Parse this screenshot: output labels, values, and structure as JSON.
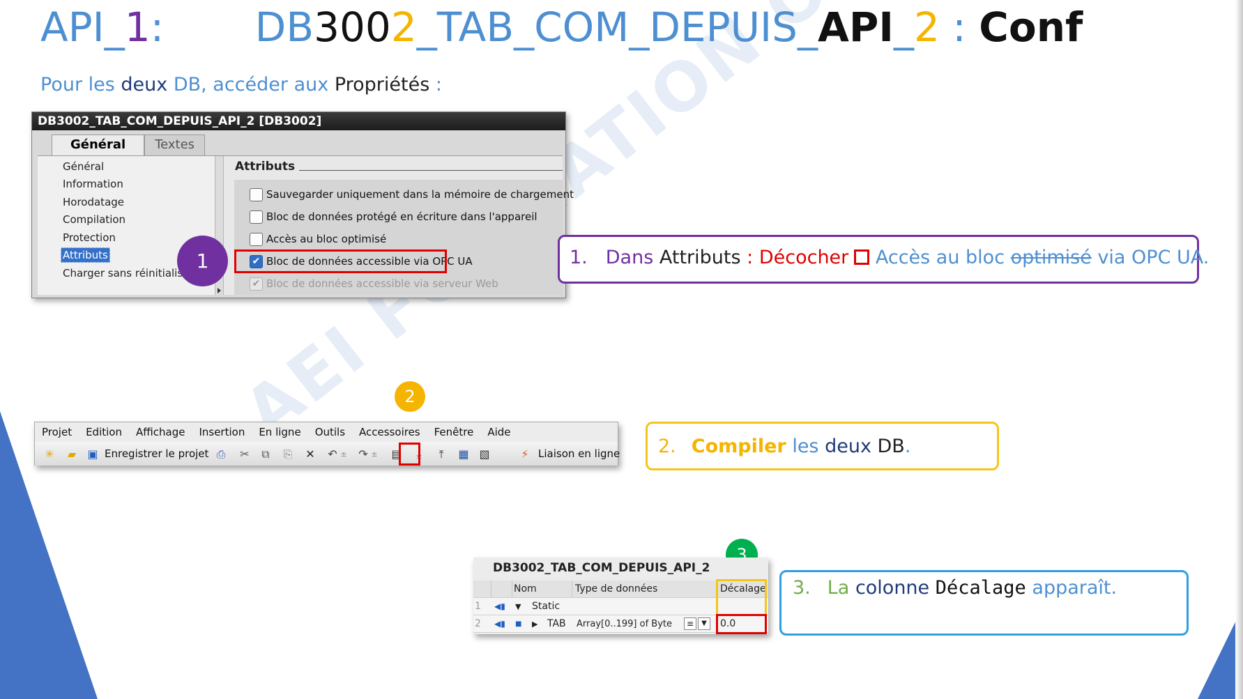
{
  "title": {
    "part1_a": "API_",
    "part1_b": "1",
    "part1_c": " :",
    "part2_a": "DB",
    "part2_b": "300",
    "part2_c": "2",
    "part2_d": "_TAB_COM_DEPUIS_",
    "part2_e": "API",
    "part2_f": "_",
    "part2_g": "2",
    "part2_h": " : ",
    "part2_i": "Conf"
  },
  "subtitle": {
    "a": "Pour les ",
    "b": "deux",
    "c": " DB, accéder aux ",
    "d": "Propriétés",
    "e": " :"
  },
  "properties_window": {
    "title": "DB3002_TAB_COM_DEPUIS_API_2 [DB3002]",
    "tabs": [
      "Général",
      "Textes"
    ],
    "nav_items": [
      "Général",
      "Information",
      "Horodatage",
      "Compilation",
      "Protection",
      "Attributs",
      "Charger sans réinitialis"
    ],
    "section_title": "Attributs",
    "checkboxes": [
      {
        "label": "Sauvegarder uniquement dans la mémoire de chargement",
        "checked": false
      },
      {
        "label": "Bloc de données protégé en écriture dans l'appareil",
        "checked": false
      },
      {
        "label": "Accès au bloc optimisé",
        "checked": false
      },
      {
        "label": "Bloc de données accessible via OPC UA",
        "checked": true
      },
      {
        "label": "Bloc de données accessible via serveur Web",
        "checked": true,
        "disabled": true
      }
    ]
  },
  "badges": {
    "one": "1",
    "two": "2",
    "three": "3"
  },
  "callout1": {
    "num": "1.",
    "a": "Dans ",
    "b": "Attributs",
    "c": " : ",
    "d": "Décocher",
    "e": " Accès au bloc ",
    "f": "optimisé",
    "g": " via OPC UA."
  },
  "toolbar_window": {
    "menu": [
      "Projet",
      "Edition",
      "Affichage",
      "Insertion",
      "En ligne",
      "Outils",
      "Accessoires",
      "Fenêtre",
      "Aide"
    ],
    "save_label": "Enregistrer le projet",
    "online_label": "Liaison en ligne"
  },
  "callout2": {
    "num": "2.",
    "a": "Compiler",
    "b": " les ",
    "c": "deux",
    "d": " DB",
    "e": "."
  },
  "table_window": {
    "title": "DB3002_TAB_COM_DEPUIS_API_2",
    "headers": [
      "Nom",
      "Type de données",
      "Décalage"
    ],
    "rows": [
      {
        "idx": "1",
        "name": "Static",
        "type": "",
        "offset": ""
      },
      {
        "idx": "2",
        "name": "TAB",
        "type": "Array[0..199] of Byte",
        "offset": "0.0"
      }
    ]
  },
  "callout3": {
    "num": "3.",
    "a": "La ",
    "b": "colonne",
    "c": " ",
    "d": "Décalage",
    "e": " apparaît."
  },
  "watermark": "AEI FORMATION OUEST",
  "colors": {
    "blue": "#4e8fd1",
    "purple": "#7030a0",
    "orange": "#f5b400",
    "green": "#00b050",
    "red": "#e00000",
    "cyan": "#2f9fe0"
  }
}
